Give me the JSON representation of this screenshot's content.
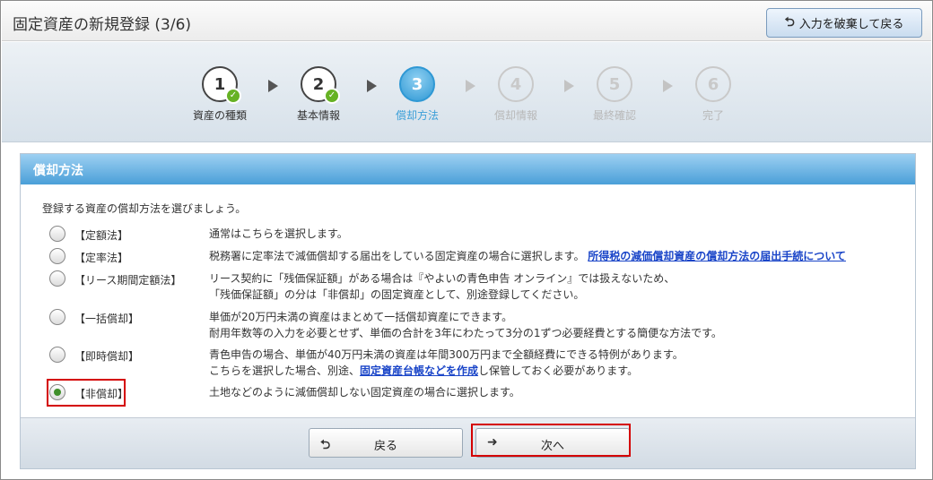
{
  "header": {
    "title": "固定資産の新規登録 (3/6)",
    "discard_label": "入力を破棄して戻る"
  },
  "steps": [
    {
      "num": "1",
      "label": "資産の種類",
      "state": "done"
    },
    {
      "num": "2",
      "label": "基本情報",
      "state": "done"
    },
    {
      "num": "3",
      "label": "償却方法",
      "state": "current"
    },
    {
      "num": "4",
      "label": "償却情報",
      "state": "future"
    },
    {
      "num": "5",
      "label": "最終確認",
      "state": "future"
    },
    {
      "num": "6",
      "label": "完了",
      "state": "future"
    }
  ],
  "panel": {
    "title": "償却方法",
    "intro": "登録する資産の償却方法を選びましょう。"
  },
  "options": [
    {
      "name": "【定額法】",
      "desc1": "通常はこちらを選択します。",
      "selected": false
    },
    {
      "name": "【定率法】",
      "desc1": "税務署に定率法で減価償却する届出をしている固定資産の場合に選択します。",
      "link": "所得税の減価償却資産の償却方法の届出手続について",
      "selected": false
    },
    {
      "name": "【リース期間定額法】",
      "desc1": "リース契約に「残価保証額」がある場合は『やよいの青色申告 オンライン』では扱えないため、",
      "desc2": "「残価保証額」の分は「非償却」の固定資産として、別途登録してください。",
      "selected": false
    },
    {
      "name": "【一括償却】",
      "desc1": "単価が20万円未満の資産はまとめて一括償却資産にできます。",
      "desc2": "耐用年数等の入力を必要とせず、単価の合計を3年にわたって3分の1ずつ必要経費とする簡便な方法です。",
      "selected": false
    },
    {
      "name": "【即時償却】",
      "desc1": "青色申告の場合、単価が40万円未満の資産は年間300万円まで全額経費にできる特例があります。",
      "desc2_pre": "こちらを選択した場合、別途、",
      "desc2_link": "固定資産台帳などを作成",
      "desc2_post": "し保管しておく必要があります。",
      "selected": false
    },
    {
      "name": "【非償却】",
      "desc1": "土地などのように減価償却しない固定資産の場合に選択します。",
      "selected": true
    }
  ],
  "footer": {
    "back_label": "戻る",
    "next_label": "次へ"
  },
  "colors": {
    "accent_blue": "#3b9fd8",
    "highlight_red": "#d40000",
    "check_green": "#66b224",
    "link_blue": "#1a45c8"
  }
}
